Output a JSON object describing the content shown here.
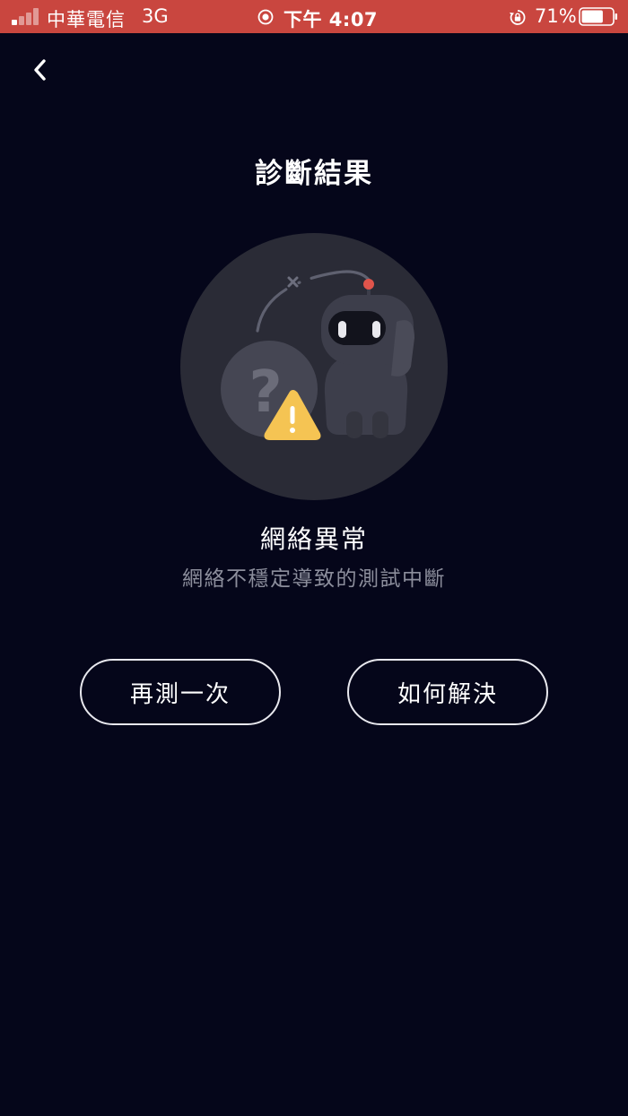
{
  "status_bar": {
    "carrier": "中華電信",
    "network": "3G",
    "time": "下午 4:07",
    "battery_percent": "71%",
    "battery_level": 0.71,
    "background_color": "#c9463f"
  },
  "header": {
    "back_icon": "chevron-left-icon",
    "title": "診斷結果"
  },
  "illustration": {
    "icons": [
      "robot-icon",
      "question-mark-icon",
      "warning-icon"
    ],
    "warning_color": "#f5c453",
    "antenna_color": "#e0544b"
  },
  "result": {
    "title": "網絡異常",
    "subtitle": "網絡不穩定導致的測試中斷"
  },
  "actions": {
    "retry_label": "再測一次",
    "solve_label": "如何解決"
  },
  "theme": {
    "background": "#05061a",
    "text_primary": "#ffffff",
    "text_secondary": "#8c8e9c"
  }
}
